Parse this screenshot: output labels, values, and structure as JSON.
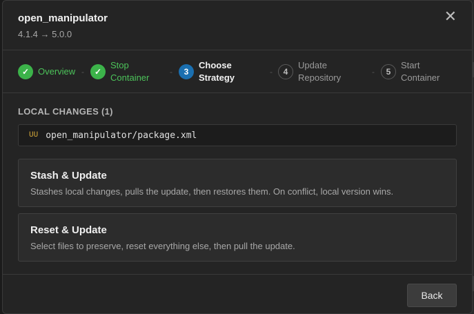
{
  "dialog": {
    "title": "open_manipulator",
    "version_change": "4.1.4 → 5.0.0",
    "close_glyph": "✕"
  },
  "steps": [
    {
      "number": "1",
      "label": "Overview",
      "state": "done"
    },
    {
      "number": "2",
      "label": "Stop Container",
      "state": "done"
    },
    {
      "number": "3",
      "label": "Choose Strategy",
      "state": "active"
    },
    {
      "number": "4",
      "label": "Update Repository",
      "state": "pending"
    },
    {
      "number": "5",
      "label": "Start Container",
      "state": "pending"
    }
  ],
  "step_separator": "-",
  "check_glyph": "✓",
  "local_changes": {
    "heading": "LOCAL CHANGES (1)",
    "files": [
      {
        "status": "UU",
        "path": "open_manipulator/package.xml"
      }
    ]
  },
  "options": [
    {
      "title": "Stash & Update",
      "description": "Stashes local changes, pulls the update, then restores them. On conflict, local version wins."
    },
    {
      "title": "Reset & Update",
      "description": "Select files to preserve, reset everything else, then pull the update."
    }
  ],
  "footer": {
    "back_label": "Back"
  },
  "colors": {
    "done": "#3cb34a",
    "active": "#1a6fb0",
    "file_status": "#d6a93a",
    "background": "#242424"
  }
}
